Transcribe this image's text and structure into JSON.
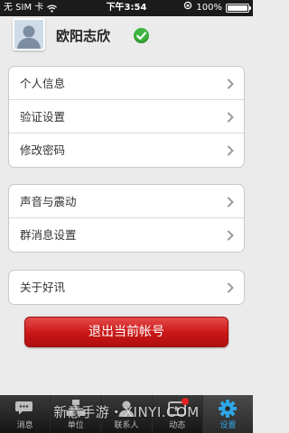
{
  "status_bar": {
    "carrier": "无 SIM 卡",
    "time": "下午3:54",
    "battery": "100%",
    "battery_level": 1.0
  },
  "profile": {
    "name": "欧阳志欣",
    "verified": true
  },
  "groups": [
    {
      "items": [
        {
          "label": "个人信息"
        },
        {
          "label": "验证设置"
        },
        {
          "label": "修改密码"
        }
      ]
    },
    {
      "items": [
        {
          "label": "声音与震动"
        },
        {
          "label": "群消息设置"
        }
      ]
    },
    {
      "items": [
        {
          "label": "关于好讯"
        }
      ]
    }
  ],
  "logout_label": "退出当前帐号",
  "tabs": [
    {
      "label": "消息",
      "icon": "chat-icon",
      "active": false
    },
    {
      "label": "单位",
      "icon": "organization-icon",
      "active": false
    },
    {
      "label": "联系人",
      "icon": "contacts-icon",
      "active": false
    },
    {
      "label": "动态",
      "icon": "moments-icon",
      "active": false,
      "badge": true
    },
    {
      "label": "设置",
      "icon": "gear-icon",
      "active": true
    }
  ],
  "watermark": "新意手游・XINYI.COM",
  "colors": {
    "logout_red": "#c91616",
    "active_tab": "#2ea7e8",
    "verified_green": "#3fb43f",
    "badge_red": "#e52222"
  }
}
